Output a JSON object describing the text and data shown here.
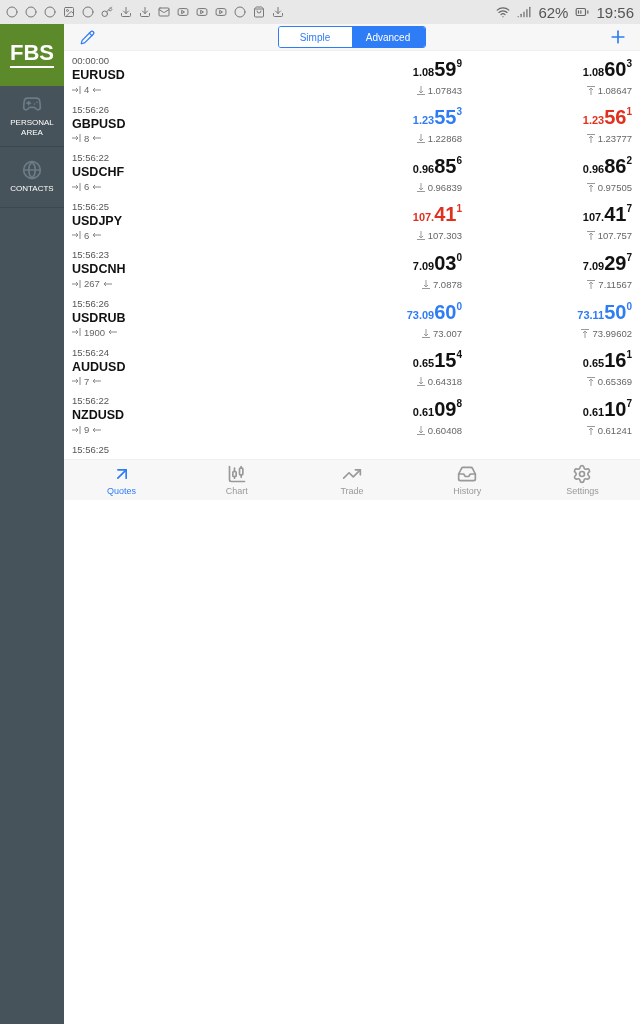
{
  "status_bar": {
    "battery": "62%",
    "time": "19:56"
  },
  "sidebar": {
    "logo": "FBS",
    "items": [
      {
        "kind": "gamepad",
        "label": "PERSONAL AREA"
      },
      {
        "kind": "globe",
        "label": "CONTACTS"
      }
    ]
  },
  "toolbar": {
    "segments": [
      {
        "label": "Simple",
        "selected": false
      },
      {
        "label": "Advanced",
        "selected": true
      }
    ]
  },
  "quotes": [
    {
      "time": "00:00:00",
      "symbol": "EURUSD",
      "spread": "4",
      "bid": {
        "prefix": "1.08",
        "big": "59",
        "sup": "9",
        "color": "#111111"
      },
      "ask": {
        "prefix": "1.08",
        "big": "60",
        "sup": "3",
        "color": "#111111"
      },
      "low": "1.07843",
      "high": "1.08647"
    },
    {
      "time": "15:56:26",
      "symbol": "GBPUSD",
      "spread": "8",
      "bid": {
        "prefix": "1.23",
        "big": "55",
        "sup": "3",
        "color": "#2e7cf6"
      },
      "ask": {
        "prefix": "1.23",
        "big": "56",
        "sup": "1",
        "color": "#e0301e"
      },
      "low": "1.22868",
      "high": "1.23777"
    },
    {
      "time": "15:56:22",
      "symbol": "USDCHF",
      "spread": "6",
      "bid": {
        "prefix": "0.96",
        "big": "85",
        "sup": "6",
        "color": "#111111"
      },
      "ask": {
        "prefix": "0.96",
        "big": "86",
        "sup": "2",
        "color": "#111111"
      },
      "low": "0.96839",
      "high": "0.97505"
    },
    {
      "time": "15:56:25",
      "symbol": "USDJPY",
      "spread": "6",
      "bid": {
        "prefix": "107.",
        "big": "41",
        "sup": "1",
        "color": "#e0301e"
      },
      "ask": {
        "prefix": "107.",
        "big": "41",
        "sup": "7",
        "color": "#111111"
      },
      "low": "107.303",
      "high": "107.757"
    },
    {
      "time": "15:56:23",
      "symbol": "USDCNH",
      "spread": "267",
      "bid": {
        "prefix": "7.09",
        "big": "03",
        "sup": "0",
        "color": "#111111"
      },
      "ask": {
        "prefix": "7.09",
        "big": "29",
        "sup": "7",
        "color": "#111111"
      },
      "low": "7.0878",
      "high": "7.11567"
    },
    {
      "time": "15:56:26",
      "symbol": "USDRUB",
      "spread": "1900",
      "bid": {
        "prefix": "73.09",
        "big": "60",
        "sup": "0",
        "color": "#2e7cf6"
      },
      "ask": {
        "prefix": "73.11",
        "big": "50",
        "sup": "0",
        "color": "#2e7cf6"
      },
      "low": "73.007",
      "high": "73.99602"
    },
    {
      "time": "15:56:24",
      "symbol": "AUDUSD",
      "spread": "7",
      "bid": {
        "prefix": "0.65",
        "big": "15",
        "sup": "4",
        "color": "#111111"
      },
      "ask": {
        "prefix": "0.65",
        "big": "16",
        "sup": "1",
        "color": "#111111"
      },
      "low": "0.64318",
      "high": "0.65369"
    },
    {
      "time": "15:56:22",
      "symbol": "NZDUSD",
      "spread": "9",
      "bid": {
        "prefix": "0.61",
        "big": "09",
        "sup": "8",
        "color": "#111111"
      },
      "ask": {
        "prefix": "0.61",
        "big": "10",
        "sup": "7",
        "color": "#111111"
      },
      "low": "0.60408",
      "high": "0.61241"
    },
    {
      "time": "15:56:25"
    }
  ],
  "tabs": [
    {
      "kind": "quotes",
      "label": "Quotes",
      "selected": true
    },
    {
      "kind": "chart",
      "label": "Chart",
      "selected": false
    },
    {
      "kind": "trade",
      "label": "Trade",
      "selected": false
    },
    {
      "kind": "history",
      "label": "History",
      "selected": false
    },
    {
      "kind": "settings",
      "label": "Settings",
      "selected": false
    }
  ]
}
